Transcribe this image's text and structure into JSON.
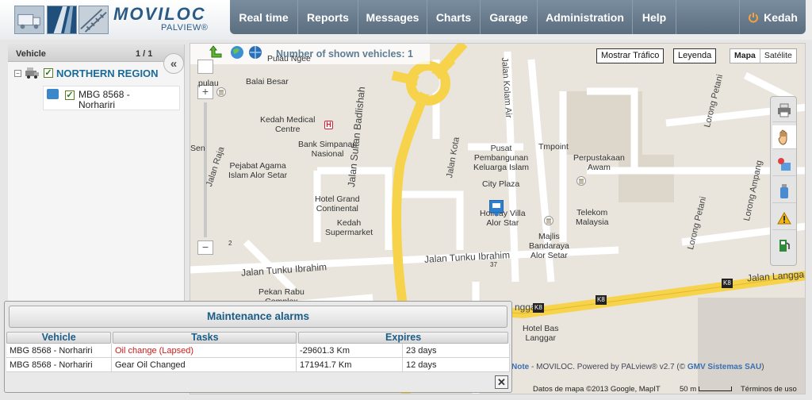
{
  "brand": {
    "name": "MOVILOC",
    "subtitle": "PALVIEW",
    "registered": "®"
  },
  "nav": {
    "items": [
      "Real time",
      "Reports",
      "Messages",
      "Charts",
      "Garage",
      "Administration",
      "Help"
    ],
    "user": "Kedah"
  },
  "vehicle_panel": {
    "header": "Vehicle",
    "count": "1 / 1",
    "collapse_label": "«",
    "region": {
      "name": "NORTHERN REGION",
      "checked": true
    },
    "vehicles": [
      {
        "name": "MBG 8568 - Norhariri",
        "checked": true
      }
    ]
  },
  "map": {
    "shown_vehicles_text": "Number of shown vehicles: 1",
    "traffic_button": "Mostrar Tráfico",
    "legend_button": "Leyenda",
    "map_types": [
      "Mapa",
      "Satélite"
    ],
    "selected_map_type": "Mapa",
    "zoom_in": "+",
    "zoom_out": "−",
    "places": {
      "pulau_ngee": "Pulau Ngee",
      "balai_besar": "Balai Besar",
      "kedah_medical_1": "Kedah Medical",
      "kedah_medical_2": "Centre",
      "bank_1": "Bank Simpanan",
      "bank_2": "Nasional",
      "pejabat_1": "Pejabat Agama",
      "pejabat_2": "Islam Alor Setar",
      "pusat_1": "Pusat",
      "pusat_2": "Pembangunan",
      "pusat_3": "Keluarga Islam",
      "tmpoint": "Tmpoint",
      "perpus_1": "Perpustakaan",
      "perpus_2": "Awam",
      "city_plaza": "City Plaza",
      "hotel_grand_1": "Hotel Grand",
      "hotel_grand_2": "Continental",
      "kedah_super_1": "Kedah",
      "kedah_super_2": "Supermarket",
      "holiday_1": "Holiday Villa",
      "holiday_2": "Alor Star",
      "telekom_1": "Telekom",
      "telekom_2": "Malaysia",
      "majlis_1": "Majlis",
      "majlis_2": "Bandaraya",
      "majlis_3": "Alor Setar",
      "pekan_1": "Pekan Rabu",
      "pekan_2": "Complex",
      "hotel_bas_1": "Hotel Bas",
      "hotel_bas_2": "Langgar",
      "pulau_l": "pulau",
      "senl": "Sen"
    },
    "roads": {
      "jalan_tunku_ibrahim_1": "Jalan Tunku Ibrahim",
      "jalan_tunku_ibrahim_2": "Jalan Tunku Ibrahim",
      "jalan_sultan_badlishah": "Jalan Sultan Badlishah",
      "jalan_kota": "Jalan Kota",
      "jalan_kolam_air": "Jalan Kolam Air",
      "jalan_raja": "Jalan Raja",
      "lorong_petani_1": "Lorong Petani",
      "lorong_petani_2": "Lorong Petani",
      "lorong_ampang": "Lorong Ampang",
      "jalan_langgar": "Jalan Langga",
      "langgar": "nggar",
      "k8_1": "K8",
      "k8_2": "K8",
      "k8_3": "K8",
      "num_37": "37",
      "num_2": "2"
    },
    "footer": {
      "note": "Note",
      "powered": "MOVILOC. Powered by PALview® v2.7 (©",
      "gmv": "GMV Sistemas SAU",
      "paren": ")",
      "copyright": "Datos de mapa ©2013 Google, MapIT",
      "scale": "50 m",
      "terms": "Términos de uso"
    }
  },
  "maintenance": {
    "title": "Maintenance alarms",
    "columns": [
      "Vehicle",
      "Tasks",
      "Expires"
    ],
    "rows": [
      {
        "vehicle": "MBG 8568 - Norhariri",
        "task": "Oil change (Lapsed)",
        "km": "-29601.3 Km",
        "days": "23 days",
        "lapsed": true
      },
      {
        "vehicle": "MBG 8568 - Norhariri",
        "task": "Gear Oil Changed",
        "km": "171941.7 Km",
        "days": "12 days",
        "lapsed": false
      }
    ],
    "close_label": "✕"
  },
  "colors": {
    "nav": "#6a7d8f",
    "brand": "#2a5b86",
    "road_major": "#f6d34a",
    "lapsed": "#d21a1a",
    "grid_header_text": "#1c5d87"
  }
}
